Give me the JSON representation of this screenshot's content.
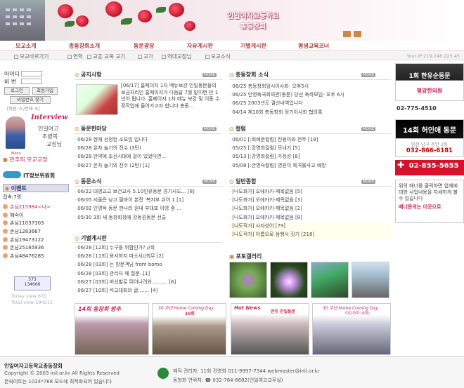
{
  "header": {
    "title_line1": "인일여자고등학교",
    "title_line2": "총동창회"
  },
  "nav": [
    "모교소개",
    "총동창회소개",
    "동문광장",
    "자유게시판",
    "기별게시판",
    "평생교육코너"
  ],
  "subnav": [
    "모교바로가기",
    "연혁",
    "교훈 교목 교기",
    "교가",
    "역대교장님",
    "모교소식"
  ],
  "ip": "Your IP:219.248.225.45",
  "login": {
    "id_label": "아이디",
    "pw_label": "비 번",
    "login_btn": "로그인",
    "join_btn": "회원가입",
    "find_btn": "비밀번호 찾기",
    "hint": "[회원: 0 /전체: 6]"
  },
  "interview": {
    "title": "Interview",
    "line1": "인일여고",
    "line2": "조병복",
    "line3": "교장님",
    "menu_label": "Menu",
    "link1": "만추의 모교교정",
    "link2": "IT정보위원회",
    "event_label": "이벤트",
    "online_label": "접속:7명"
  },
  "guests": [
    "손님215984<나>",
    "혜숙이",
    "손님11037303",
    "손님1283667",
    "손님19473122",
    "손님25165936",
    "손님48476285"
  ],
  "counter": {
    "top": "573",
    "bottom": "134666",
    "today": "Today view   670",
    "total": "Total view  594215"
  },
  "notice": {
    "title": "공지사항",
    "more": "MORE",
    "text": "[06/17] 홈페이지 1차 메뉴보강 인일동문들의 보금자리인 홈페이지가 다듬달 7월 말이면 만 1년이 됩니다. 홈페이지 1차 메뉴 보강 및 이동 수정작업에 들어가고자 합니다 총동..."
  },
  "alumni_news": {
    "title": "총동창회 소식",
    "more": "MORE",
    "items": [
      "06/25 총동창회임시이사회- 오후5시",
      "06/25 인영축국회의관(동문) 당선 축하모임- 오후 6시",
      "06/25 2003년도 결산내역입니다",
      "04/14 제10회 총동창회 정기이사회 협의록"
    ]
  },
  "alumni_plaza": {
    "title": "동문한마당",
    "more": "MORE",
    "items": [
      "06/28 현재 선정된 소모임 입니다",
      "06/28 온자 놀기의 진수 (3탄)",
      "06/28 만약에 조선시대에 겉이 있었다면...",
      "06/27 온자 놀기의 진수 (2탄) [1]"
    ]
  },
  "column": {
    "title": "컬럼",
    "more": "MORE",
    "items": [
      "06/01 [:회예문컬럼] 진용이와 전주 [19]",
      "05/25 [:강명희컬럼] 모내기 [5]",
      "05/13 [:강명희컬럼] 가정성 [8]",
      "05/08 [:안명숙컬럼] 영원이 목격률사고 예방"
    ]
  },
  "alumni_news2": {
    "title": "동문소식",
    "more": "MORE",
    "items": [
      "06/22 대명교고 보건교사 5.10인유동문 경기사도... [8]",
      "06/05 서울은 낮고 딸바이 본전 '복지부 쉬어 1 [1]",
      "06/02 인명옥 동문 한나라 원내 부대표 이명 중 ...",
      "05/30 3회 새 동창회장에 강동원동문 선출"
    ]
  },
  "general": {
    "title": "일반종합",
    "more": "MORE",
    "items": [
      "[나도화가] 오에카키-제목없음 [5]",
      "[나도화가] 오에카키-제목없음 [3]",
      "[나도화가] 오에카키-제목없음 [2]",
      "[나도화가] 오에카키-제목없음 [8]",
      "[나도작가] 사자성어 [79]",
      "[나도작가] 이름으로 삼행시 짓기 [218]"
    ]
  },
  "class_board": {
    "title": "기별게시판",
    "items": [
      "06/28 [12회] 누구를 위함인가? //최",
      "06/28 [11회] 용서하지 마소서//최무 [2]",
      "06/28 [03회] 는 방문객님 from bomo",
      "06/28 [03회] 관리자 께 질문..[1]",
      "06/27 [03회] 버선발로 뛰어나려와.......... [6]",
      "06/27 [10회] 석고대죄의 글....... [4]"
    ]
  },
  "photo": {
    "title": "포토갤러리"
  },
  "thumbs": [
    {
      "title": "14회 동창회 밤추"
    },
    {
      "title": "30 주년 Home Coming Day",
      "sub": "10회"
    },
    {
      "title": "Hot News",
      "sub": "만주 인일동문"
    },
    {
      "title": "30 주년 Home Coming Day",
      "sub": "이브자회 (9회)"
    }
  ],
  "right_ads": {
    "ad1_top": "1회 한유순동문",
    "ad1_bottom": "평강한의원",
    "phone1": "02-775-4510",
    "ad2_title": "14회 허인애 동문",
    "ad2_addr": "인천 남구 주안 2동",
    "ad2_phone": "032-866-6181",
    "ad3_phone": "02-855-5655",
    "ad4_text": "위의 배너를 클릭하면 업체에 대한 사업내용을 자세하게 볼 수 있습니다",
    "ad4_link": "배너문의는 이곳으로"
  },
  "footer": {
    "org": "인일여자고등학교총동창회",
    "copy": "Copyright © 2003 inil.or.kr All Rights Reserved",
    "res": "본싸이트는 1024*768 모드에 최적화되어 있습니다",
    "admin": "제작 관리자: 11회 전영희 011-9997-7344 webmaster@inil.or.kr",
    "contact": "동창회 연락처: ☎ 032-764-6682(인일여고교무실)"
  }
}
